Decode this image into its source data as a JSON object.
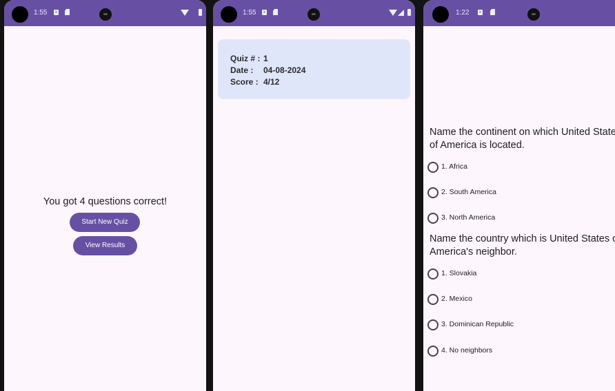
{
  "screens": [
    {
      "status": {
        "time": "1:55"
      },
      "result_text": "You got 4 questions correct!",
      "buttons": {
        "start_new_quiz": "Start New Quiz",
        "view_results": "View Results"
      }
    },
    {
      "status": {
        "time": "1:55"
      },
      "result_card": {
        "rows": [
          {
            "label": "Quiz # :",
            "value": "1"
          },
          {
            "label": "Date :",
            "value": "04-08-2024"
          },
          {
            "label": "Score :",
            "value": "4/12"
          }
        ]
      }
    },
    {
      "status": {
        "time": "1:22"
      },
      "questions": [
        {
          "text": "Name the continent on which United States of America is located.",
          "options": [
            "1. Africa",
            "2. South America",
            "3. North America"
          ]
        },
        {
          "text": "Name the country which is United States of America's neighbor.",
          "options": [
            "1. Slovakia",
            "2. Mexico",
            "3. Dominican Republic",
            "4. No neighbors"
          ]
        }
      ]
    }
  ],
  "colors": {
    "accent": "#6750a4",
    "background": "#fdf7fd",
    "card": "#e0e6fa"
  }
}
